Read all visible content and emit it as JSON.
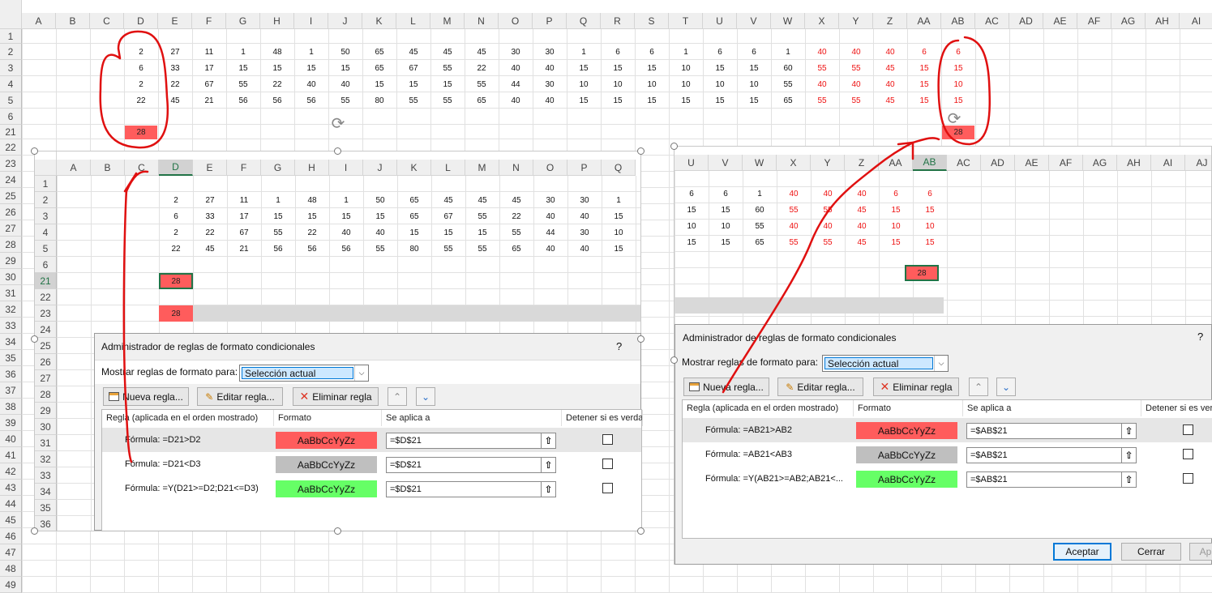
{
  "main": {
    "columns": [
      "A",
      "B",
      "C",
      "D",
      "E",
      "F",
      "G",
      "H",
      "I",
      "J",
      "K",
      "L",
      "M",
      "N",
      "O",
      "P",
      "Q",
      "R",
      "S",
      "T",
      "U",
      "V",
      "W",
      "X",
      "Y",
      "Z",
      "AA",
      "AB",
      "AC",
      "AD",
      "AE",
      "AF",
      "AG",
      "AH",
      "AI"
    ],
    "rows": [
      "1",
      "2",
      "3",
      "4",
      "5",
      "6",
      "21",
      "22",
      "23",
      "24",
      "25",
      "26",
      "27",
      "28",
      "29",
      "30",
      "31",
      "32",
      "33",
      "34",
      "35",
      "36",
      "37",
      "38",
      "39",
      "40",
      "41",
      "42",
      "43",
      "44",
      "45",
      "46",
      "47",
      "48",
      "49"
    ],
    "data": [
      [
        "2",
        "27",
        "11",
        "1",
        "48",
        "1",
        "50",
        "65",
        "45",
        "45",
        "45",
        "30",
        "30",
        "1",
        "6",
        "6",
        "1",
        "6",
        "6",
        "1",
        "40",
        "40",
        "40",
        "6",
        "6"
      ],
      [
        "6",
        "33",
        "17",
        "15",
        "15",
        "15",
        "15",
        "65",
        "67",
        "55",
        "22",
        "40",
        "40",
        "15",
        "15",
        "15",
        "10",
        "15",
        "15",
        "60",
        "55",
        "55",
        "45",
        "15",
        "15"
      ],
      [
        "2",
        "22",
        "67",
        "55",
        "22",
        "40",
        "40",
        "15",
        "15",
        "15",
        "55",
        "44",
        "30",
        "10",
        "10",
        "10",
        "10",
        "10",
        "10",
        "55",
        "40",
        "40",
        "40",
        "15",
        "10"
      ],
      [
        "22",
        "45",
        "21",
        "56",
        "56",
        "56",
        "55",
        "80",
        "55",
        "55",
        "65",
        "40",
        "40",
        "15",
        "15",
        "15",
        "15",
        "15",
        "15",
        "65",
        "55",
        "55",
        "45",
        "15",
        "15"
      ]
    ],
    "d21": "28",
    "ab21": "28"
  },
  "left_window": {
    "columns": [
      "A",
      "B",
      "C",
      "D",
      "E",
      "F",
      "G",
      "H",
      "I",
      "J",
      "K",
      "L",
      "M",
      "N",
      "O",
      "P",
      "Q"
    ],
    "rows": [
      "1",
      "2",
      "3",
      "4",
      "5",
      "6",
      "21",
      "22",
      "23",
      "24",
      "25",
      "26",
      "27",
      "28",
      "29",
      "30",
      "31",
      "32",
      "33",
      "34",
      "35",
      "36"
    ],
    "data": [
      [
        "2",
        "27",
        "11",
        "1",
        "48",
        "1",
        "50",
        "65",
        "45",
        "45",
        "45",
        "30",
        "30",
        "1"
      ],
      [
        "6",
        "33",
        "17",
        "15",
        "15",
        "15",
        "15",
        "65",
        "67",
        "55",
        "22",
        "40",
        "40",
        "15"
      ],
      [
        "2",
        "22",
        "67",
        "55",
        "22",
        "40",
        "40",
        "15",
        "15",
        "15",
        "55",
        "44",
        "30",
        "10"
      ],
      [
        "22",
        "45",
        "21",
        "56",
        "56",
        "56",
        "55",
        "80",
        "55",
        "55",
        "65",
        "40",
        "40",
        "15"
      ]
    ],
    "d21": "28",
    "d23": "28"
  },
  "right_window": {
    "columns": [
      "U",
      "V",
      "W",
      "X",
      "Y",
      "Z",
      "AA",
      "AB",
      "AC",
      "AD",
      "AE",
      "AF",
      "AG",
      "AH",
      "AI",
      "AJ"
    ],
    "data": [
      [
        "6",
        "6",
        "1",
        "40",
        "40",
        "40",
        "6",
        "6"
      ],
      [
        "15",
        "15",
        "60",
        "55",
        "55",
        "45",
        "15",
        "15"
      ],
      [
        "10",
        "10",
        "55",
        "40",
        "40",
        "40",
        "10",
        "10"
      ],
      [
        "15",
        "15",
        "65",
        "55",
        "55",
        "45",
        "15",
        "15"
      ]
    ],
    "ab21": "28"
  },
  "dialog_left": {
    "title": "Administrador de reglas de formato condicionales",
    "help": "?",
    "show_label": "Mostrar reglas de formato para:",
    "show_value": "Selección actual",
    "new_rule": "Nueva regla...",
    "edit_rule": "Editar regla...",
    "delete_rule": "Eliminar regla",
    "col_rule": "Regla (aplicada en el orden mostrado)",
    "col_format": "Formato",
    "col_applies": "Se aplica a",
    "col_stop": "Detener si es verdad",
    "rules": [
      {
        "formula": "Fórmula: =D21>D2",
        "preview": "AaBbCcYyZz",
        "applies": "=$D$21",
        "color": "#ff5c5c"
      },
      {
        "formula": "Fórmula: =D21<D3",
        "preview": "AaBbCcYyZz",
        "applies": "=$D$21",
        "color": "#bfbfbf"
      },
      {
        "formula": "Fórmula: =Y(D21>=D2;D21<=D3)",
        "preview": "AaBbCcYyZz",
        "applies": "=$D$21",
        "color": "#66ff66"
      }
    ]
  },
  "dialog_right": {
    "title": "Administrador de reglas de formato condicionales",
    "help": "?",
    "show_label": "Mostrar reglas de formato para:",
    "show_value": "Selección actual",
    "new_rule": "Nueva regla...",
    "edit_rule": "Editar regla...",
    "delete_rule": "Eliminar regla",
    "col_rule": "Regla (aplicada en el orden mostrado)",
    "col_format": "Formato",
    "col_applies": "Se aplica a",
    "col_stop": "Detener si es verdad",
    "rules": [
      {
        "formula": "Fórmula: =AB21>AB2",
        "preview": "AaBbCcYyZz",
        "applies": "=$AB$21",
        "color": "#ff5c5c"
      },
      {
        "formula": "Fórmula: =AB21<AB3",
        "preview": "AaBbCcYyZz",
        "applies": "=$AB$21",
        "color": "#bfbfbf"
      },
      {
        "formula": "Fórmula: =Y(AB21>=AB2;AB21<...",
        "preview": "AaBbCcYyZz",
        "applies": "=$AB$21",
        "color": "#66ff66"
      }
    ],
    "ok": "Aceptar",
    "close": "Cerrar",
    "apply": "Ap"
  },
  "colors": {
    "red_fill": "#ff5c5c",
    "red_text": "#e11111",
    "selection": "#217346",
    "annotation": "#e01010"
  }
}
